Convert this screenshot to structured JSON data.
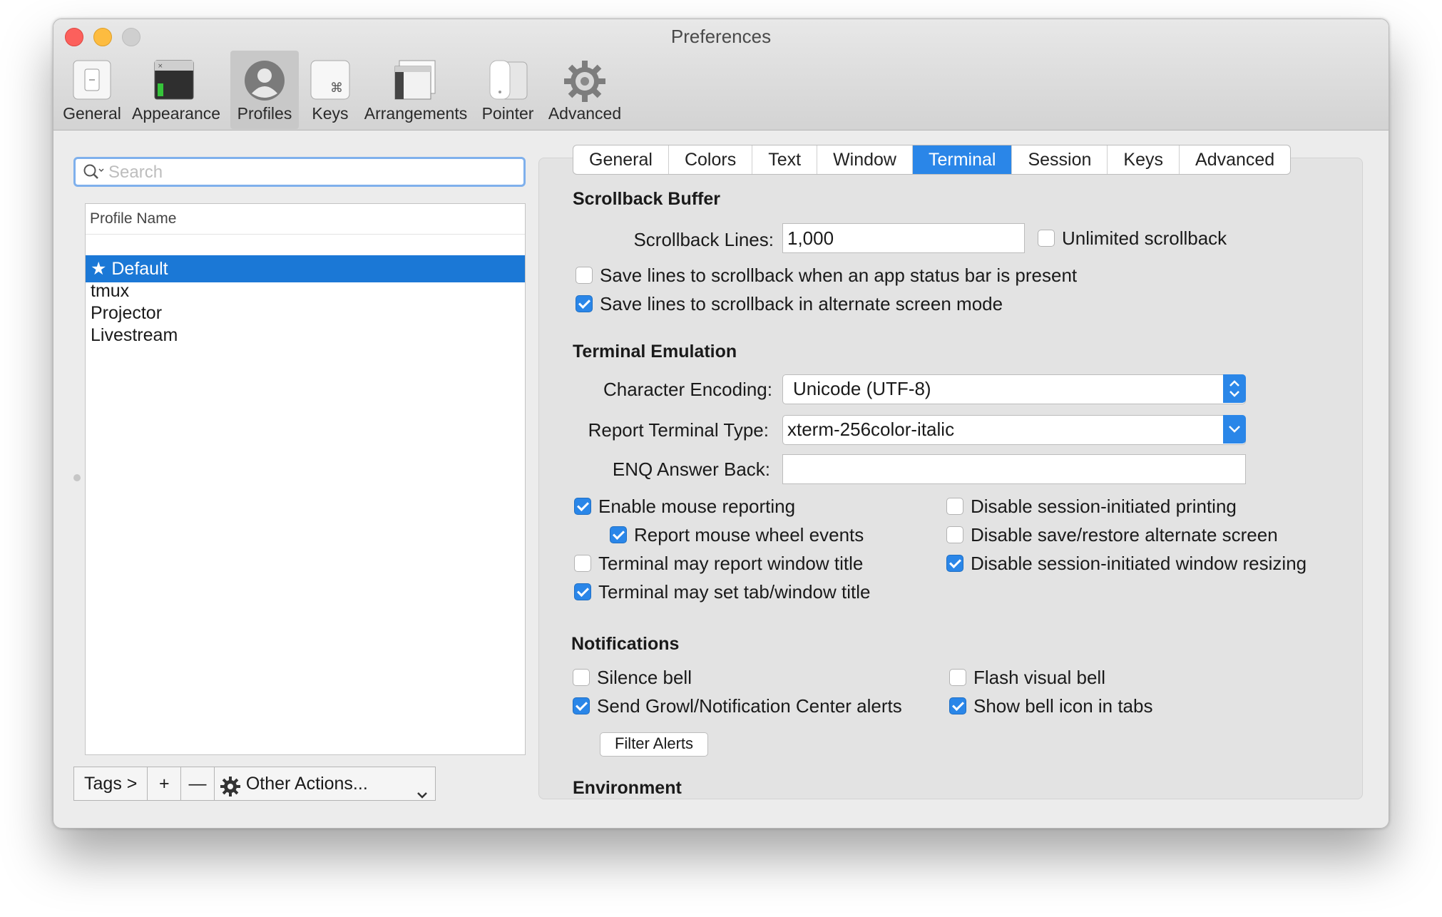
{
  "window": {
    "title": "Preferences"
  },
  "toolbar": {
    "items": [
      {
        "label": "General",
        "icon": "switch-icon"
      },
      {
        "label": "Appearance",
        "icon": "window-icon"
      },
      {
        "label": "Profiles",
        "icon": "user-icon"
      },
      {
        "label": "Keys",
        "icon": "command-key-icon"
      },
      {
        "label": "Arrangements",
        "icon": "arrangement-icon"
      },
      {
        "label": "Pointer",
        "icon": "mouse-icon"
      },
      {
        "label": "Advanced",
        "icon": "gear-icon"
      }
    ],
    "selected": "Profiles"
  },
  "search": {
    "placeholder": "Search",
    "value": ""
  },
  "profiles": {
    "header": "Profile Name",
    "items": [
      "★ Default",
      "tmux",
      "Projector",
      "Livestream"
    ],
    "selected": "★ Default"
  },
  "bottombar": {
    "tags": "Tags >",
    "add": "+",
    "remove": "—",
    "other_actions": "Other Actions..."
  },
  "tabs": {
    "items": [
      "General",
      "Colors",
      "Text",
      "Window",
      "Terminal",
      "Session",
      "Keys",
      "Advanced"
    ],
    "active": "Terminal"
  },
  "scrollback": {
    "title": "Scrollback Buffer",
    "lines_label": "Scrollback Lines:",
    "lines_value": "1,000",
    "unlimited": {
      "label": "Unlimited scrollback",
      "checked": false
    },
    "save_status_bar": {
      "label": "Save lines to scrollback when an app status bar is present",
      "checked": false
    },
    "save_alternate": {
      "label": "Save lines to scrollback in alternate screen mode",
      "checked": true
    }
  },
  "emulation": {
    "title": "Terminal Emulation",
    "encoding_label": "Character Encoding:",
    "encoding_value": "Unicode (UTF-8)",
    "type_label": "Report Terminal Type:",
    "type_value": "xterm-256color-italic",
    "enq_label": "ENQ Answer Back:",
    "enq_value": "",
    "mouse_reporting": {
      "label": "Enable mouse reporting",
      "checked": true
    },
    "mouse_wheel": {
      "label": "Report mouse wheel events",
      "checked": true
    },
    "report_title": {
      "label": "Terminal may report window title",
      "checked": false
    },
    "set_title": {
      "label": "Terminal may set tab/window title",
      "checked": true
    },
    "disable_printing": {
      "label": "Disable session-initiated printing",
      "checked": false
    },
    "disable_alt_screen": {
      "label": "Disable save/restore alternate screen",
      "checked": false
    },
    "disable_resizing": {
      "label": "Disable session-initiated window resizing",
      "checked": true
    }
  },
  "notifications": {
    "title": "Notifications",
    "silence_bell": {
      "label": "Silence bell",
      "checked": false
    },
    "growl": {
      "label": "Send Growl/Notification Center alerts",
      "checked": true
    },
    "flash_bell": {
      "label": "Flash visual bell",
      "checked": false
    },
    "bell_icon": {
      "label": "Show bell icon in tabs",
      "checked": true
    },
    "filter_button": "Filter Alerts"
  },
  "environment": {
    "title": "Environment"
  },
  "colors": {
    "accent": "#2a86e8",
    "selection": "#1b78d6"
  }
}
